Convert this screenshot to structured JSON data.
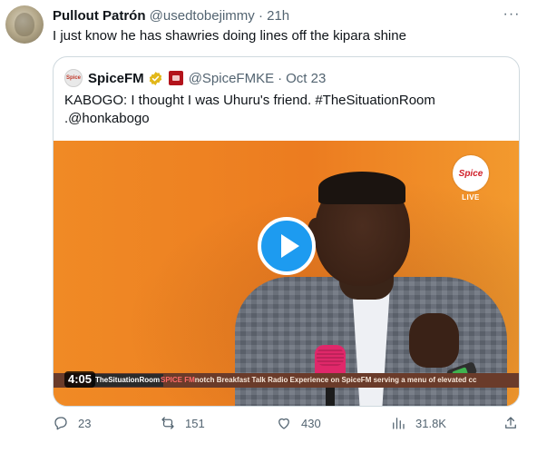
{
  "tweet": {
    "author_name": "Pullout Patrón",
    "author_handle": "@usedtobejimmy",
    "separator": "·",
    "time": "21h",
    "text": "I just know he has shawries doing lines off the kipara shine"
  },
  "quoted": {
    "avatar_text": "Spice",
    "author_name": "SpiceFM",
    "author_handle": "@SpiceFMKE",
    "separator": "·",
    "date": "Oct 23",
    "text_line1": "KABOGO: I thought I was Uhuru's friend. #TheSituationRoom",
    "text_line2": ".@honkabogo",
    "video": {
      "duration": "4:05",
      "channel_logo": "Spice",
      "live_label": "LIVE",
      "ticker_tag": "TheSituationRoom",
      "ticker_brand": "SPICE FM",
      "ticker_text": "notch Breakfast Talk Radio Experience on SpiceFM serving a menu of elevated cc"
    }
  },
  "actions": {
    "replies": "23",
    "retweets": "151",
    "likes": "430",
    "views": "31.8K"
  },
  "colors": {
    "accent": "#1d9bf0",
    "muted": "#536471",
    "video_bg": "#ee7f22",
    "verified_gold": "#e2b719"
  },
  "icons": [
    "more-icon",
    "verified-gold-icon",
    "affiliate-badge-icon",
    "play-icon",
    "reply-icon",
    "retweet-icon",
    "like-icon",
    "views-icon",
    "share-icon"
  ]
}
